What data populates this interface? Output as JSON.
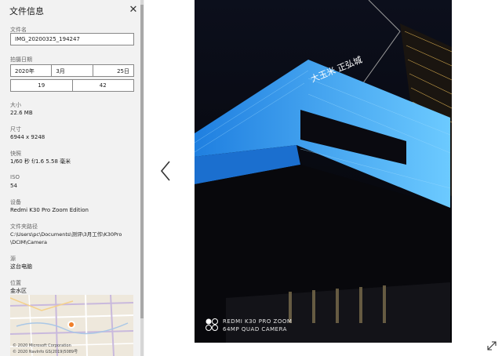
{
  "panel": {
    "title": "文件信息",
    "close_icon": "close-icon",
    "filename": {
      "label": "文件名",
      "value": "IMG_20200325_194247"
    },
    "date_taken": {
      "label": "拍摄日期",
      "year": "2020年",
      "month": "3月",
      "day": "25日",
      "hour": "19",
      "minute": "42"
    },
    "size": {
      "label": "大小",
      "value": "22.6 MB"
    },
    "dimensions": {
      "label": "尺寸",
      "value": "6944 x 9248"
    },
    "shutter": {
      "label": "快照",
      "value": "1/60 秒 f/1.6 5.58 毫米"
    },
    "iso": {
      "label": "ISO",
      "value": "54"
    },
    "device": {
      "label": "设备",
      "value": "Redmi K30 Pro Zoom Edition"
    },
    "folder": {
      "label": "文件夹路径",
      "line1": "C:\\Users\\pc\\Documents\\测评\\3月工作\\K30Pro",
      "line2": "\\DCIM\\Camera"
    },
    "source": {
      "label": "源",
      "value": "这台电脑"
    },
    "location": {
      "label": "位置",
      "value": "金水区"
    },
    "map": {
      "credit1": "© 2020 Microsoft Corporation",
      "credit2": "© 2020 NavInfo GS(2019)5089号",
      "pin_color": "#f07f2a"
    }
  },
  "viewer": {
    "prev_icon": "chevron-left-icon",
    "expand_icon": "expand-icon",
    "watermark_line1": "REDMI K30 PRO ZOOM",
    "watermark_line2": "64MP QUAD CAMERA",
    "sign_text": "大玉米 正弘城"
  },
  "colors": {
    "panel_bg": "#f2f2f2",
    "photo_bg": "#07080e",
    "glow_blue": "#4fb3ff"
  }
}
